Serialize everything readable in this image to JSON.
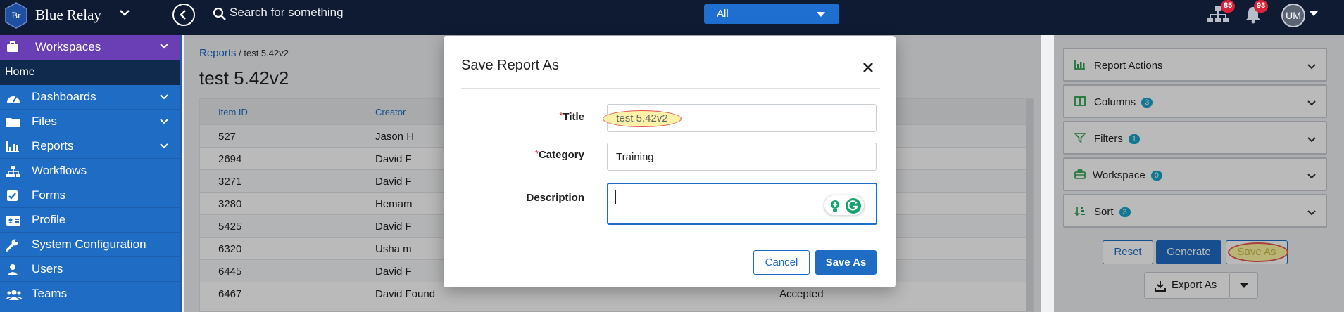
{
  "topbar": {
    "logo_text": "Br",
    "brand": "Blue Relay",
    "search_placeholder": "Search for something",
    "scope": "All",
    "org_badge": "85",
    "bell_badge": "93",
    "avatar": "UM"
  },
  "sidebar": {
    "workspaces": "Workspaces",
    "home": "Home",
    "items": [
      {
        "label": "Dashboards",
        "icon": "gauge-icon",
        "expandable": true
      },
      {
        "label": "Files",
        "icon": "folder-icon",
        "expandable": true
      },
      {
        "label": "Reports",
        "icon": "bar-chart-icon",
        "expandable": true
      },
      {
        "label": "Workflows",
        "icon": "sitemap-icon",
        "expandable": false
      },
      {
        "label": "Forms",
        "icon": "checkbox-icon",
        "expandable": false
      },
      {
        "label": "Profile",
        "icon": "id-card-icon",
        "expandable": false
      },
      {
        "label": "System Configuration",
        "icon": "wrench-icon",
        "expandable": false
      },
      {
        "label": "Users",
        "icon": "user-icon",
        "expandable": false
      },
      {
        "label": "Teams",
        "icon": "users-icon",
        "expandable": false
      }
    ]
  },
  "main": {
    "breadcrumb_link": "Reports",
    "breadcrumb_rest": " / test 5.42v2",
    "title": "test 5.42v2",
    "columns": [
      "Item ID",
      "Creator"
    ],
    "rows": [
      {
        "id": "527",
        "creator": "Jason H",
        "status": ""
      },
      {
        "id": "2694",
        "creator": "David F",
        "status": ""
      },
      {
        "id": "3271",
        "creator": "David F",
        "status": ""
      },
      {
        "id": "3280",
        "creator": "Hemam",
        "status": ""
      },
      {
        "id": "5425",
        "creator": "David F",
        "status": ""
      },
      {
        "id": "6320",
        "creator": "Usha m",
        "status": ""
      },
      {
        "id": "6445",
        "creator": "David F",
        "status": ""
      },
      {
        "id": "6467",
        "creator": "David Found",
        "status": "Accepted"
      }
    ]
  },
  "right_panel": {
    "sections": [
      {
        "label": "Report Actions",
        "icon": "bar-chart-icon",
        "badge": ""
      },
      {
        "label": "Columns",
        "icon": "columns-icon",
        "badge": "3"
      },
      {
        "label": "Filters",
        "icon": "filter-icon",
        "badge": "1"
      },
      {
        "label": "Workspace",
        "icon": "briefcase-icon",
        "badge": "0"
      },
      {
        "label": "Sort",
        "icon": "sort-icon",
        "badge": "3"
      }
    ],
    "reset": "Reset",
    "generate": "Generate",
    "save_as": "Save As",
    "export_as": "Export As"
  },
  "modal": {
    "title": "Save Report As",
    "title_label": "Title",
    "title_value": "test 5.42v2",
    "category_label": "Category",
    "category_value": "Training",
    "description_label": "Description",
    "description_value": "",
    "required_mark": "*",
    "cancel": "Cancel",
    "save": "Save As"
  },
  "colors": {
    "topbar": "#0f1b33",
    "sidebar": "#1f6cc4",
    "workspaces": "#6a3fb5",
    "accent": "#1f6cc4",
    "badge_red": "#d8243a",
    "badge_teal": "#1aa3c8"
  }
}
